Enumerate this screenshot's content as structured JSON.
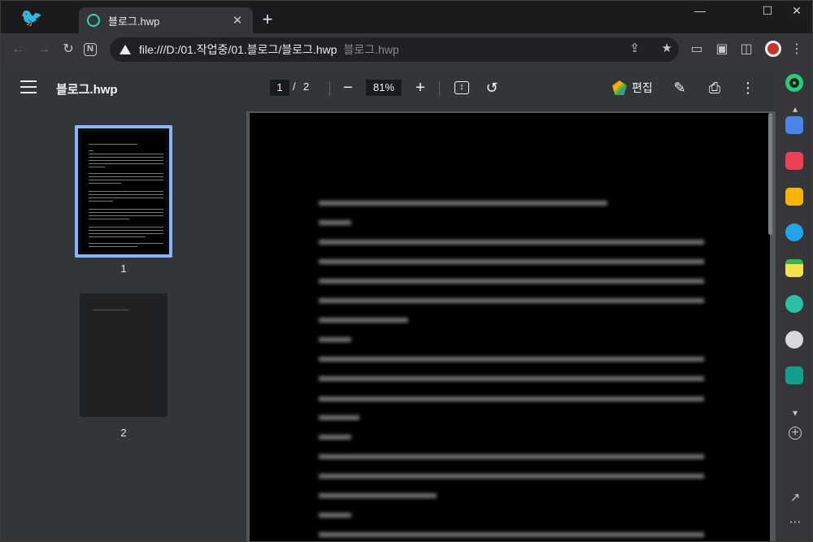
{
  "browser": {
    "tab_title": "블로그.hwp",
    "tab_close": "✕",
    "new_tab": "+",
    "win_min": "—",
    "win_max": "☐",
    "win_close": "✕",
    "url": "file:///D:/01.작업중/01.블로그/블로그.hwp",
    "url_suffix": "블로그.hwp"
  },
  "pdf": {
    "title": "블로그.hwp",
    "current_page": "1",
    "page_separator": "/",
    "total_pages": "2",
    "zoom": "81%",
    "edit_label": "편집"
  },
  "thumbnails": [
    {
      "label": "1",
      "selected": true
    },
    {
      "label": "2",
      "selected": false
    }
  ],
  "colors": {
    "accent": "#8ab4f8",
    "favicon": "#2fd6b0",
    "profile": "#c9312b"
  },
  "side_panel_icons": [
    "whale-icon",
    "briefcase-icon",
    "pocket-icon",
    "star-icon",
    "papago-icon",
    "note-icon",
    "play-icon",
    "avatar-icon",
    "gamepad-icon"
  ]
}
